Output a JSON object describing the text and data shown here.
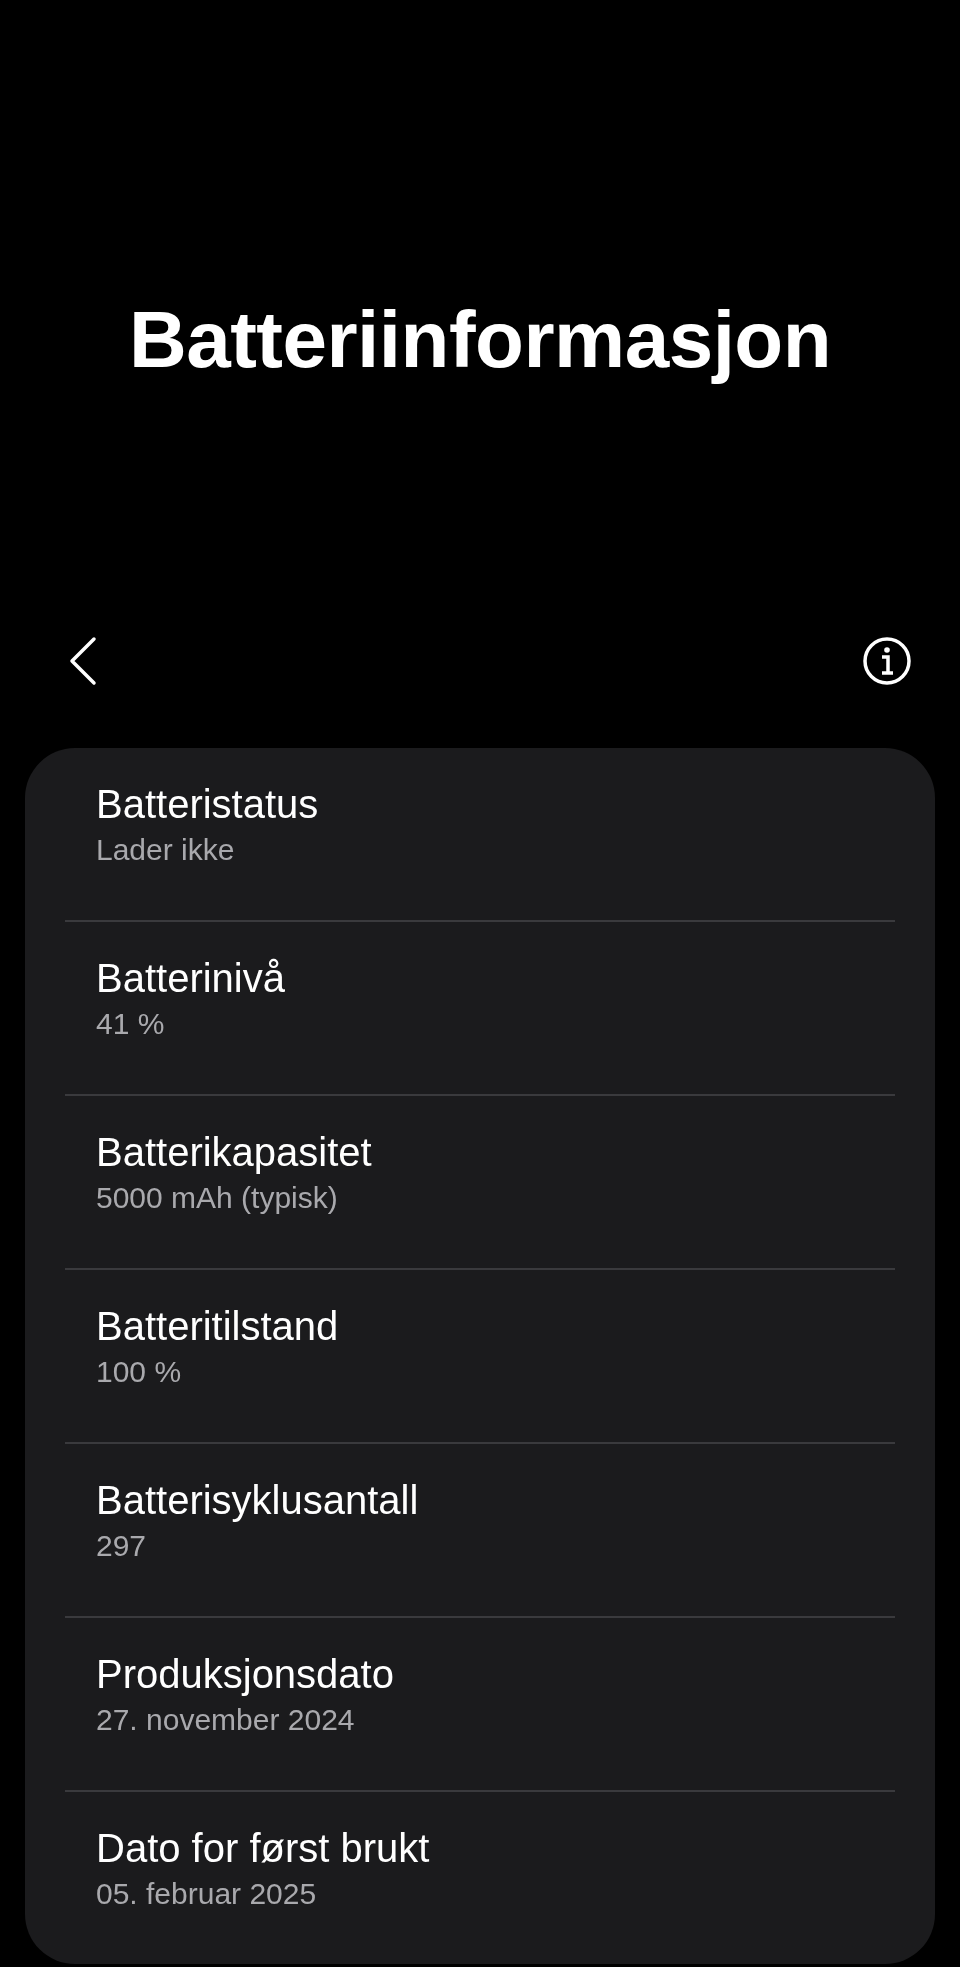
{
  "header": {
    "title": "Batteriinformasjon"
  },
  "items": [
    {
      "label": "Batteristatus",
      "value": "Lader ikke"
    },
    {
      "label": "Batterinivå",
      "value": "41 %"
    },
    {
      "label": "Batterikapasitet",
      "value": "5000 mAh (typisk)"
    },
    {
      "label": "Batteritilstand",
      "value": "100 %"
    },
    {
      "label": "Batterisyklusantall",
      "value": "297"
    },
    {
      "label": "Produksjonsdato",
      "value": "27. november 2024"
    },
    {
      "label": "Dato for først brukt",
      "value": "05. februar 2025"
    }
  ]
}
